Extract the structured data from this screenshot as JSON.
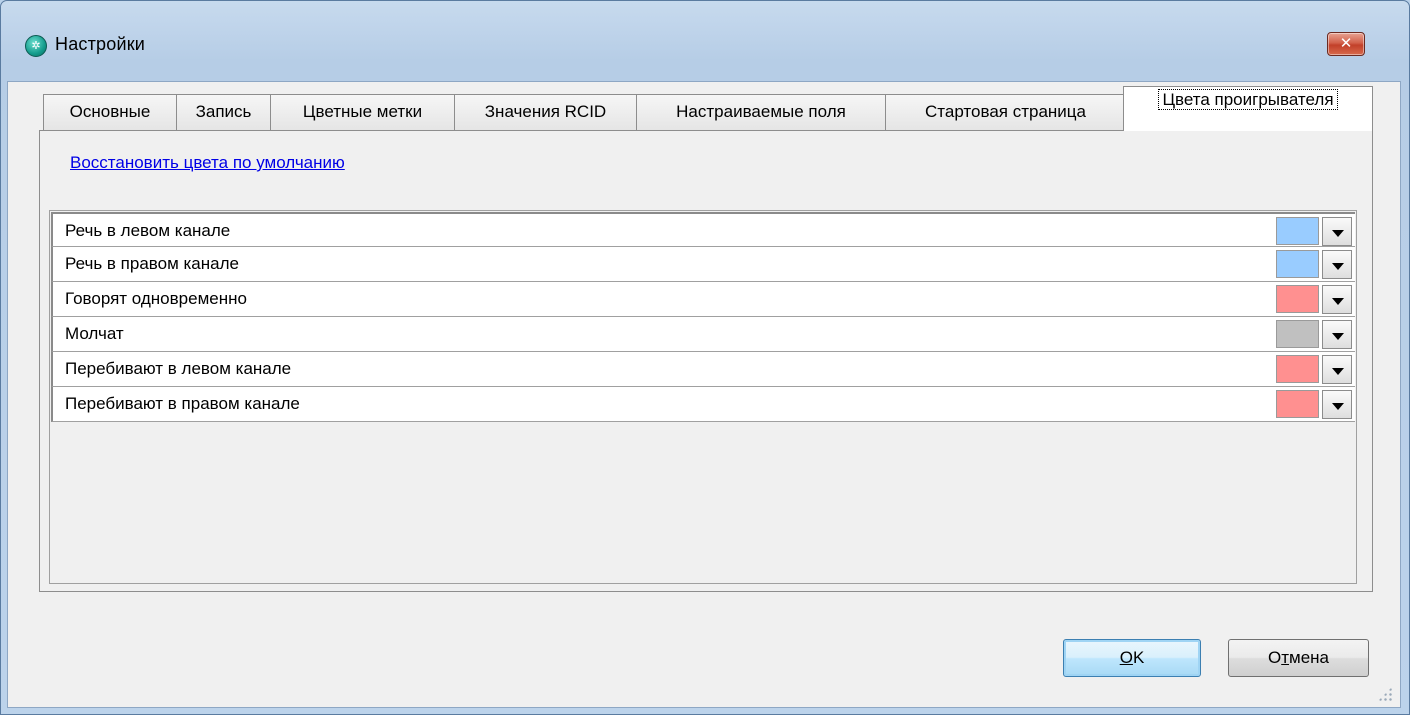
{
  "window": {
    "title": "Настройки",
    "close_glyph": "✕"
  },
  "tabs": [
    {
      "label": "Основные"
    },
    {
      "label": "Запись"
    },
    {
      "label": "Цветные метки"
    },
    {
      "label": "Значения RCID"
    },
    {
      "label": "Настраиваемые поля"
    },
    {
      "label": "Стартовая страница"
    },
    {
      "label": "Цвета проигрывателя",
      "active": true
    }
  ],
  "restore_link": "Восстановить цвета по умолчанию",
  "color_rows": [
    {
      "label": "Речь в левом канале",
      "color": "#99ccff"
    },
    {
      "label": "Речь в правом канале",
      "color": "#99ccff"
    },
    {
      "label": "Говорят одновременно",
      "color": "#ff9090"
    },
    {
      "label": "Молчат",
      "color": "#c0c0c0"
    },
    {
      "label": "Перебивают в левом канале",
      "color": "#ff9090"
    },
    {
      "label": "Перебивают в правом канале",
      "color": "#ff9090"
    }
  ],
  "buttons": {
    "ok_prefix": "",
    "ok_mnemonic": "O",
    "ok_rest": "K",
    "cancel_prefix": "О",
    "cancel_mnemonic": "т",
    "cancel_rest": "мена"
  }
}
